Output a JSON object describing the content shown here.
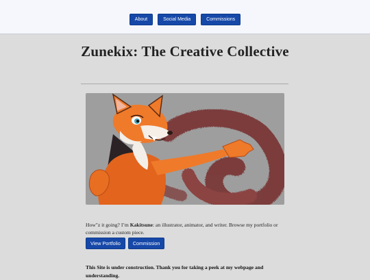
{
  "nav": {
    "items": [
      {
        "label": "About"
      },
      {
        "label": "Social Media"
      },
      {
        "label": "Commissions"
      }
    ]
  },
  "page": {
    "title": "Zunekix: The Creative Collective"
  },
  "hero": {
    "image_subject": "fox-character-illustration"
  },
  "intro": {
    "part1": "How\"z it going? I’m ",
    "name": "Kakitsune",
    "part2": ": an illustrator, animator, and writer. Browse my portfolio or commission a custom piece."
  },
  "cta": {
    "portfolio_label": "View Portfolio",
    "commission_label": "Commission"
  },
  "notice": {
    "text": "This Site is under construction. Thank you for taking a peek at my webpage and understanding."
  },
  "colors": {
    "accent": "#1648a8",
    "background": "#dcdcdc",
    "header_bg": "#f5f7fc"
  }
}
